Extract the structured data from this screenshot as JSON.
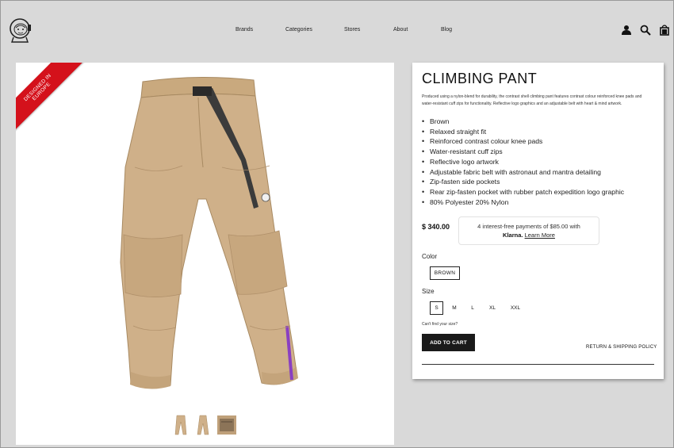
{
  "header": {
    "nav": [
      "Brands",
      "Categories",
      "Stores",
      "About",
      "Blog"
    ],
    "icons": [
      "account-icon",
      "search-icon",
      "bag-icon"
    ]
  },
  "image_panel": {
    "ribbon_line1": "DESIGNED IN",
    "ribbon_line2": "EUROPE",
    "ribbon_color": "#d4111b",
    "thumbnails": [
      "thumbnail-front",
      "thumbnail-side",
      "thumbnail-detail"
    ]
  },
  "product": {
    "title": "CLIMBING PANT",
    "description": "Produced using a nylon-blend for durability, the contrast shell climbing pant features contrast colour reinforced knee pads and water-resistant cuff zips for functionality. Reflective logo graphics and an adjustable belt with heart & mind artwork.",
    "features": [
      "Brown",
      "Relaxed straight fit",
      "Reinforced contrast colour knee pads",
      "Water-resistant cuff zips",
      "Reflective logo artwork",
      "Adjustable fabric belt with astronaut and mantra detailing",
      "Zip-fasten side pockets",
      "Rear zip-fasten pocket with rubber patch expedition logo graphic",
      "80% Polyester 20% Nylon"
    ],
    "price": "$ 340.00",
    "klarna_text": "4 interest-free payments of $85.00 with",
    "klarna_brand": "Klarna.",
    "klarna_link": "Learn More",
    "color_label": "Color",
    "color_value": "BROWN",
    "size_label": "Size",
    "sizes": [
      "S",
      "M",
      "L",
      "XL",
      "XXL"
    ],
    "selected_size": "S",
    "cant_find": "Can't find your size?",
    "add_to_cart": "ADD TO CART",
    "return_policy": "RETURN & SHIPPING POLICY"
  }
}
